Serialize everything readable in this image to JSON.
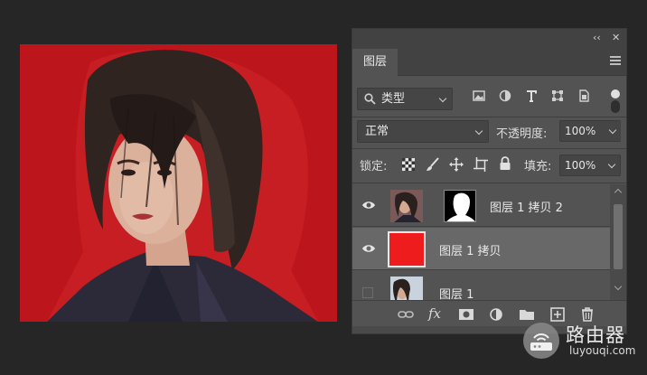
{
  "canvas": {
    "background_color": "#c0151d"
  },
  "panel": {
    "collapse_label": "‹‹",
    "close_label": "✕",
    "tab_label": "图层",
    "filter": {
      "kind_label": "类型"
    },
    "blend_mode": "正常",
    "opacity_label": "不透明度:",
    "opacity_value": "100%",
    "lock_label": "锁定:",
    "fill_label": "填充:",
    "fill_value": "100%",
    "layers": [
      {
        "name": "图层 1 拷贝 2",
        "visible": true,
        "selected": false,
        "has_mask": true
      },
      {
        "name": "图层 1 拷贝",
        "visible": true,
        "selected": true,
        "has_mask": false
      },
      {
        "name": "图层 1",
        "visible": false,
        "selected": false,
        "has_mask": false
      }
    ],
    "footer_fx_label": "fx"
  },
  "watermark": {
    "title": "路由器",
    "subtitle": "luyouqi.com"
  }
}
